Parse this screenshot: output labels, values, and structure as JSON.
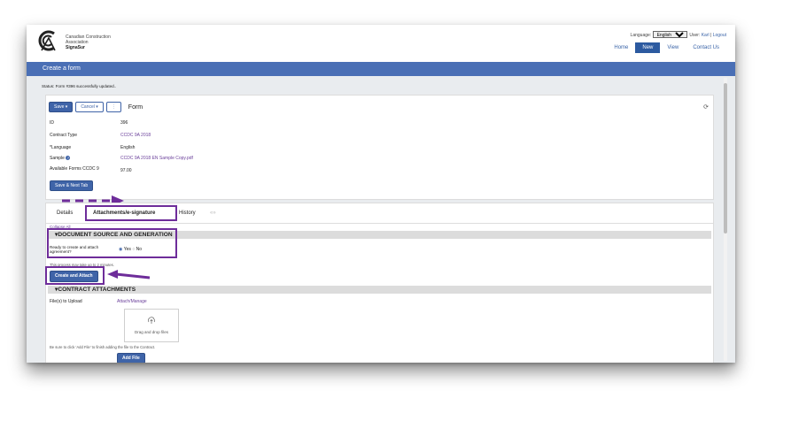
{
  "header": {
    "org_line1": "Canadian Construction",
    "org_line2": "Association",
    "org_line3": "SignaSur",
    "language_label": "Language:",
    "language_value": "English",
    "user_label": "User:",
    "user_name": "Karl",
    "separator": "|",
    "logout": "Logout",
    "nav": [
      "Home",
      "New",
      "View",
      "Contact Us"
    ]
  },
  "page_title": "Create a form",
  "status_text": "Status: Form #396 successfully updated..",
  "toolbar": {
    "save": "Save",
    "save_caret": "▾",
    "cancel": "Cancel",
    "cancel_caret": "▾",
    "more": "⋮",
    "form_label": "Form",
    "refresh_icon": "⟳"
  },
  "fields": [
    {
      "label": "ID",
      "value": "396"
    },
    {
      "label": "Contract Type",
      "value": "CCDC 9A 2018"
    },
    {
      "label": "*Language",
      "value": "English"
    },
    {
      "label": "Sample",
      "value": "CCDC 9A 2018 EN Sample Copy.pdf"
    },
    {
      "label": "Available Forms CCDC 9",
      "value": "97.00"
    }
  ],
  "save_next_tab": "Save & Next Tab",
  "tabs": [
    "Details",
    "Attachments/e-signature",
    "History"
  ],
  "tabs_arrows": "«»",
  "collapse_all": "Collapse All",
  "section_doc": "DOCUMENT SOURCE AND GENERATION",
  "ready_label_1": "Ready to create and attach",
  "ready_label_2": "agreement?",
  "radio_yes": "Yes",
  "radio_no": "No",
  "note_minutes": "This process may take up to 2 minutes.",
  "create_attach": "Create and Attach",
  "section_contract": "CONTRACT ATTACHMENTS",
  "files_label": "File(s) to Upload",
  "attach_manage": "Attach/Manage",
  "drag_drop": "Drag and drop files",
  "add_file_note": "Be sure to click 'Add File' to finish adding the file to the Contract.",
  "add_file": "Add File",
  "colors": {
    "accent": "#4a6fb5",
    "annotation": "#6e2d9a",
    "link": "#6a3f9a"
  }
}
